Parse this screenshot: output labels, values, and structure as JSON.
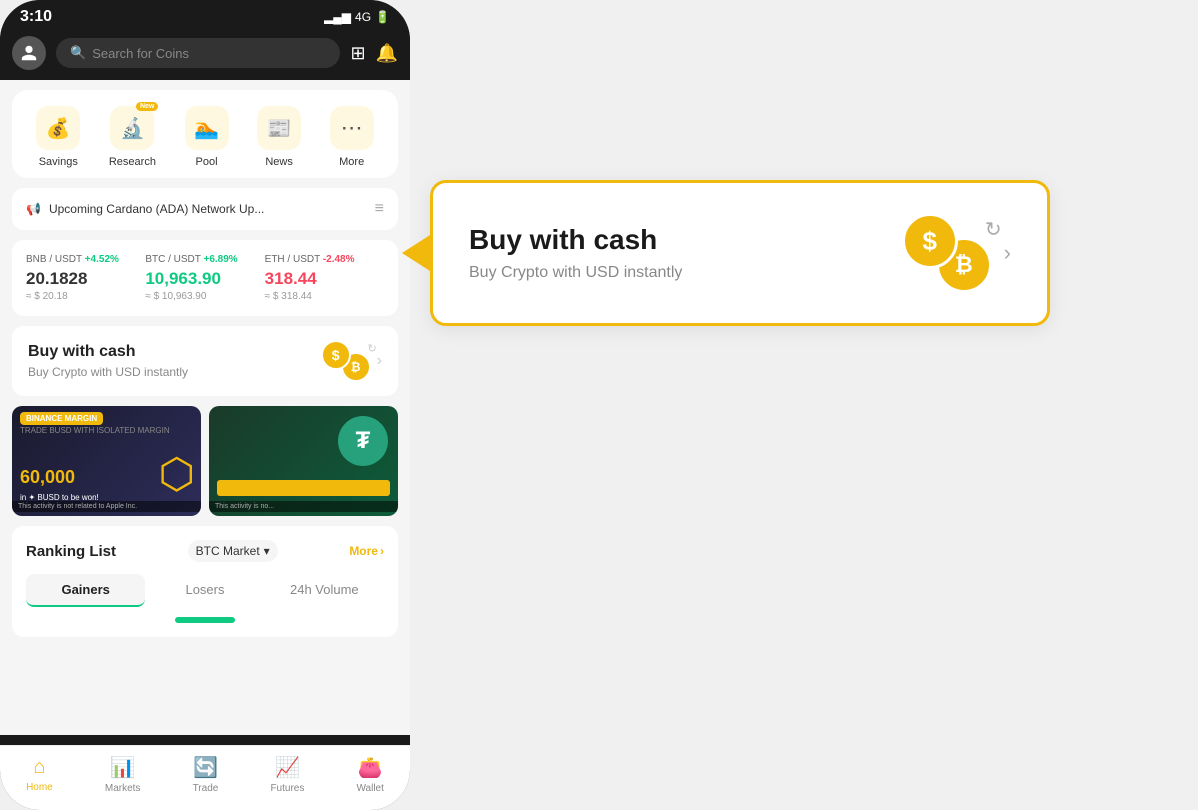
{
  "status_bar": {
    "time": "3:10",
    "signal": "▂▄▆█",
    "network": "4G",
    "battery": "🔋"
  },
  "search": {
    "placeholder": "Search for Coins"
  },
  "quick_nav": {
    "items": [
      {
        "id": "savings",
        "label": "Savings",
        "icon": "💰",
        "badge": null
      },
      {
        "id": "research",
        "label": "Research",
        "icon": "🔬",
        "badge": "New"
      },
      {
        "id": "pool",
        "label": "Pool",
        "icon": "🏊",
        "badge": null
      },
      {
        "id": "news",
        "label": "News",
        "icon": "📰",
        "badge": null
      },
      {
        "id": "more",
        "label": "More",
        "icon": "⋯",
        "badge": null
      }
    ]
  },
  "announcement": {
    "text": "Upcoming Cardano (ADA) Network Up..."
  },
  "tickers": [
    {
      "pair": "BNB / USDT",
      "change": "+4.52%",
      "positive": true,
      "price": "20.1828",
      "usd": "≈ $ 20.18"
    },
    {
      "pair": "BTC / USDT",
      "change": "+6.89%",
      "positive": true,
      "price": "10,963.90",
      "usd": "≈ $ 10,963.90"
    },
    {
      "pair": "ETH / USDT",
      "change": "-2.48%",
      "positive": false,
      "price": "318.44",
      "usd": "≈ $ 318.44"
    }
  ],
  "buy_cash": {
    "title": "Buy with cash",
    "subtitle": "Buy Crypto with USD instantly"
  },
  "callout": {
    "title": "Buy with cash",
    "subtitle": "Buy Crypto with USD instantly"
  },
  "promo": [
    {
      "badge": "BINANCE MARGIN",
      "text": "TRADE BUSD WITH ISOLATED MARGIN",
      "amount": "60,000",
      "unit": "in BUSD to be won!",
      "disclaimer": "This activity is not related to Apple Inc."
    },
    {
      "disclaimer": "This activity is no..."
    }
  ],
  "ranking": {
    "title": "Ranking List",
    "market": "BTC Market",
    "more_label": "More",
    "tabs": [
      {
        "id": "gainers",
        "label": "Gainers",
        "active": true
      },
      {
        "id": "losers",
        "label": "Losers",
        "active": false
      },
      {
        "id": "volume",
        "label": "24h Volume",
        "active": false
      }
    ]
  },
  "bottom_nav": {
    "items": [
      {
        "id": "home",
        "label": "Home",
        "icon": "🏠",
        "active": true
      },
      {
        "id": "markets",
        "label": "Markets",
        "icon": "📊",
        "active": false
      },
      {
        "id": "trade",
        "label": "Trade",
        "icon": "🔄",
        "active": false
      },
      {
        "id": "futures",
        "label": "Futures",
        "icon": "📈",
        "active": false
      },
      {
        "id": "wallet",
        "label": "Wallet",
        "icon": "👛",
        "active": false
      }
    ]
  }
}
